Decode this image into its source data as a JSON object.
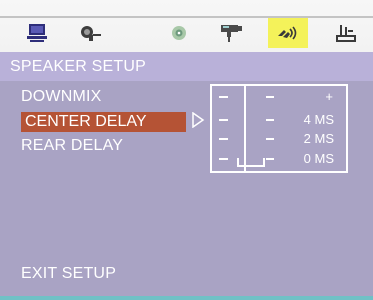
{
  "icons": [
    {
      "name": "monitor-icon"
    },
    {
      "name": "language-icon"
    },
    {
      "name": "disc-icon"
    },
    {
      "name": "video-icon"
    },
    {
      "name": "speaker-icon",
      "active": true
    },
    {
      "name": "preferences-icon"
    }
  ],
  "title": "SPEAKER SETUP",
  "menu": {
    "downmix": "DOWNMIX",
    "center_delay": "CENTER DELAY",
    "rear_delay": "REAR DELAY",
    "exit": "EXIT SETUP"
  },
  "delay_panel": {
    "labels": [
      "+",
      "4 MS",
      "2 MS",
      "0 MS"
    ],
    "selected_value": "0 MS"
  },
  "colors": {
    "background": "#a9a3c4",
    "title_bar": "#b9b1d9",
    "highlight": "#b55335",
    "active_tab": "#f4f25a"
  }
}
